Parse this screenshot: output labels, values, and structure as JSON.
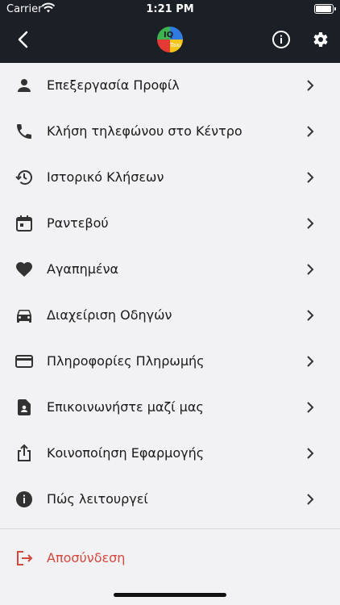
{
  "status_bar": {
    "carrier": "Carrier",
    "time": "1:21 PM"
  },
  "header": {
    "logo_text_main": "IQ",
    "logo_text_sub": "Taxi"
  },
  "menu": {
    "items": [
      {
        "label": "Επεξεργασία Προφίλ",
        "icon": "person-icon"
      },
      {
        "label": "Κλήση τηλεφώνου στο Κέντρο",
        "icon": "phone-icon"
      },
      {
        "label": "Ιστορικό Κλήσεων",
        "icon": "history-icon"
      },
      {
        "label": "Ραντεβού",
        "icon": "calendar-icon"
      },
      {
        "label": "Αγαπημένα",
        "icon": "heart-icon"
      },
      {
        "label": "Διαχείριση Οδηγών",
        "icon": "car-icon"
      },
      {
        "label": "Πληροφορίες Πληρωμής",
        "icon": "credit-card-icon"
      },
      {
        "label": "Επικοινωνήστε μαζί μας",
        "icon": "contact-document-icon"
      },
      {
        "label": "Κοινοποίηση Εφαρμογής",
        "icon": "share-icon"
      },
      {
        "label": "Πώς λειτουργεί",
        "icon": "info-filled-icon"
      }
    ],
    "logout_label": "Αποσύνδεση"
  },
  "colors": {
    "header_bg": "#1b1f26",
    "page_bg": "#f2f2f4",
    "logout": "#d4483c"
  }
}
